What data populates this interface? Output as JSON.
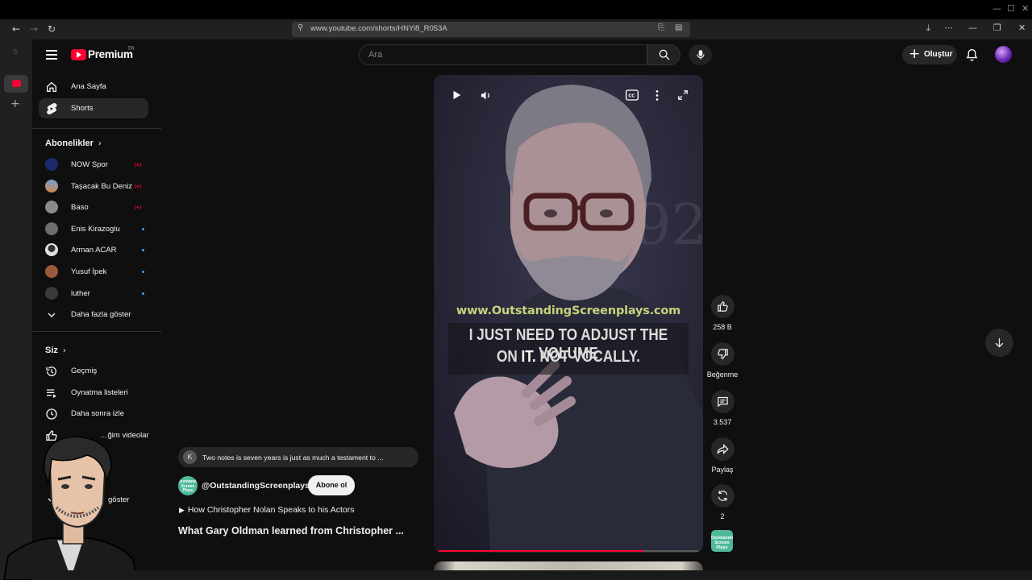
{
  "browser": {
    "url": "www.youtube.com/shorts/HNYi8_R053A",
    "edge_label": "S"
  },
  "header": {
    "logo_text": "Premium",
    "region": "TR",
    "search_placeholder": "Ara",
    "create_label": "Oluştur"
  },
  "sidebar": {
    "main": [
      {
        "label": "Ana Sayfa",
        "icon": "home-icon"
      },
      {
        "label": "Shorts",
        "icon": "shorts-icon",
        "active": true
      }
    ],
    "subscriptions_heading": "Abonelikler",
    "subscriptions": [
      {
        "label": "NOW Spor",
        "status": "live",
        "color": "#1c2a6b"
      },
      {
        "label": "Taşacak Bu Deniz",
        "status": "live",
        "color": "#d4824a"
      },
      {
        "label": "Baso",
        "status": "live",
        "color": "#8a8a8a"
      },
      {
        "label": "Enis Kirazoglu",
        "status": "new",
        "color": "#6d6d6d"
      },
      {
        "label": "Arman ACAR",
        "status": "new",
        "color": "#e0e0e0"
      },
      {
        "label": "Yusuf İpek",
        "status": "new",
        "color": "#9b5a3a"
      },
      {
        "label": "luther",
        "status": "new",
        "color": "#3a3a3a"
      }
    ],
    "show_more": "Daha fazla göster",
    "you_heading": "Siz",
    "you_items": [
      {
        "label": "Geçmiş",
        "icon": "history-icon"
      },
      {
        "label": "Oynatma listeleri",
        "icon": "playlist-icon"
      },
      {
        "label": "Daha sonra izle",
        "icon": "watch-later-icon"
      },
      {
        "label": "…ğim videolar",
        "icon": "like-icon"
      }
    ],
    "show_more_2": "göster"
  },
  "short": {
    "watermark": "www.OutstandingScreenplays.com",
    "caption_line1": "I JUST NEED TO ADJUST THE VOLUME",
    "caption_line2_a": "ON ",
    "caption_line2_b": "IT.",
    "caption_line2_c": " NOT VOCALLY.",
    "progress": 0.79
  },
  "actions": {
    "likes": "258 B",
    "dislike_label": "Beğenme",
    "comments": "3.537",
    "share_label": "Paylaş",
    "remix_count": "2",
    "channel_thumb_text": "Outstanding Screen Plays"
  },
  "info": {
    "comment_initial": "K",
    "comment_preview": "Two notes is seven years is just as much a testament to ...",
    "channel_handle": "@OutstandingScreenplays",
    "subscribe_label": "Abone ol",
    "playlist": "How Christopher Nolan Speaks to his Actors",
    "title": "What Gary Oldman learned from Christopher ..."
  },
  "colors": {
    "accent": "#ff0033",
    "background": "#0f0f0f",
    "new_dot": "#3ea6ff",
    "caption_watermark": "#c7d27c"
  }
}
